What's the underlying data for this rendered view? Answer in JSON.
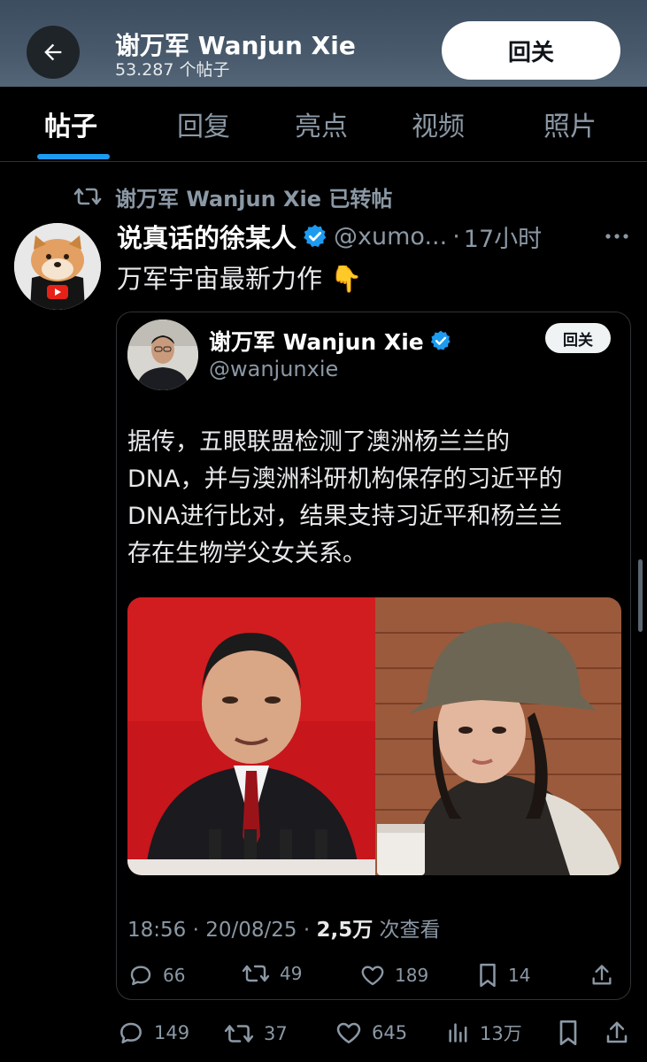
{
  "header": {
    "name": "谢万军 Wanjun Xie",
    "post_count": "53.287 个帖子",
    "follow_label": "回关"
  },
  "tabs": [
    {
      "label": "帖子",
      "active": true
    },
    {
      "label": "回复",
      "active": false
    },
    {
      "label": "亮点",
      "active": false
    },
    {
      "label": "视频",
      "active": false
    },
    {
      "label": "照片",
      "active": false
    }
  ],
  "repost": {
    "text": "谢万军 Wanjun Xie 已转帖"
  },
  "post": {
    "author": "说真话的徐某人",
    "handle": "@xumo...",
    "separator": "·",
    "time": "17小时",
    "text": "万军宇宙最新力作",
    "emoji": "👇",
    "stats": {
      "replies": "149",
      "reposts": "37",
      "likes": "645",
      "views": "13万"
    }
  },
  "quote": {
    "name": "谢万军 Wanjun Xie",
    "handle": "@wanjunxie",
    "follow_label": "回关",
    "text_lines": [
      "据传，五眼联盟检测了澳洲杨兰兰的",
      "DNA，并与澳洲科研机构保存的习近平的",
      "DNA进行比对，结果支持习近平和杨兰兰",
      "存在生物学父女关系。"
    ],
    "meta_time": "18:56 · 20/08/25 · ",
    "meta_views": "2,5万",
    "meta_views_suffix": " 次查看",
    "stats": {
      "replies": "66",
      "reposts": "49",
      "likes": "189",
      "bookmarks": "14"
    }
  },
  "colors": {
    "accent": "#1d9bf0",
    "muted": "#8b98a5",
    "background": "#000000"
  }
}
